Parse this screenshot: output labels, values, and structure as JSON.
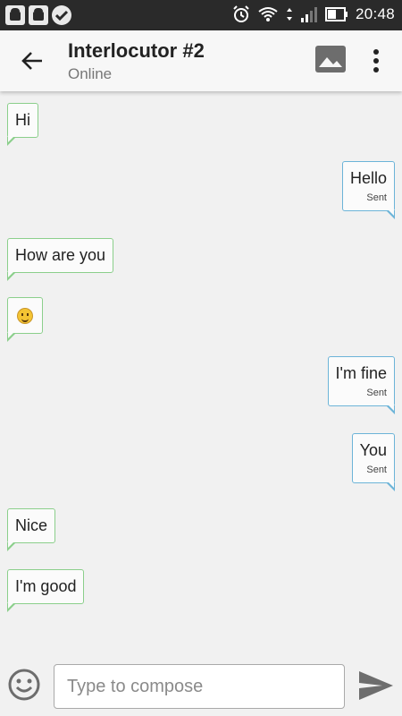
{
  "status_bar": {
    "time": "20:48"
  },
  "app_bar": {
    "title": "Interlocutor #2",
    "subtitle": "Online"
  },
  "messages": [
    {
      "direction": "in",
      "text": "Hi"
    },
    {
      "direction": "out",
      "text": "Hello",
      "status": "Sent"
    },
    {
      "direction": "in",
      "text": "How are you"
    },
    {
      "direction": "in",
      "emoji": "smiley"
    },
    {
      "direction": "out",
      "text": "I'm fine",
      "status": "Sent"
    },
    {
      "direction": "out",
      "text": "You",
      "status": "Sent"
    },
    {
      "direction": "in",
      "text": "Nice"
    },
    {
      "direction": "in",
      "text": "I'm good"
    }
  ],
  "composer": {
    "placeholder": "Type to compose",
    "value": ""
  },
  "icons": {
    "back": "arrow-left-icon",
    "image": "image-icon",
    "more": "more-vert-icon",
    "emoji": "emoji-icon",
    "send": "send-icon"
  },
  "colors": {
    "incoming_border": "#8bcf8b",
    "outgoing_border": "#6cb4d8",
    "status_bar": "#2a2a2a"
  }
}
